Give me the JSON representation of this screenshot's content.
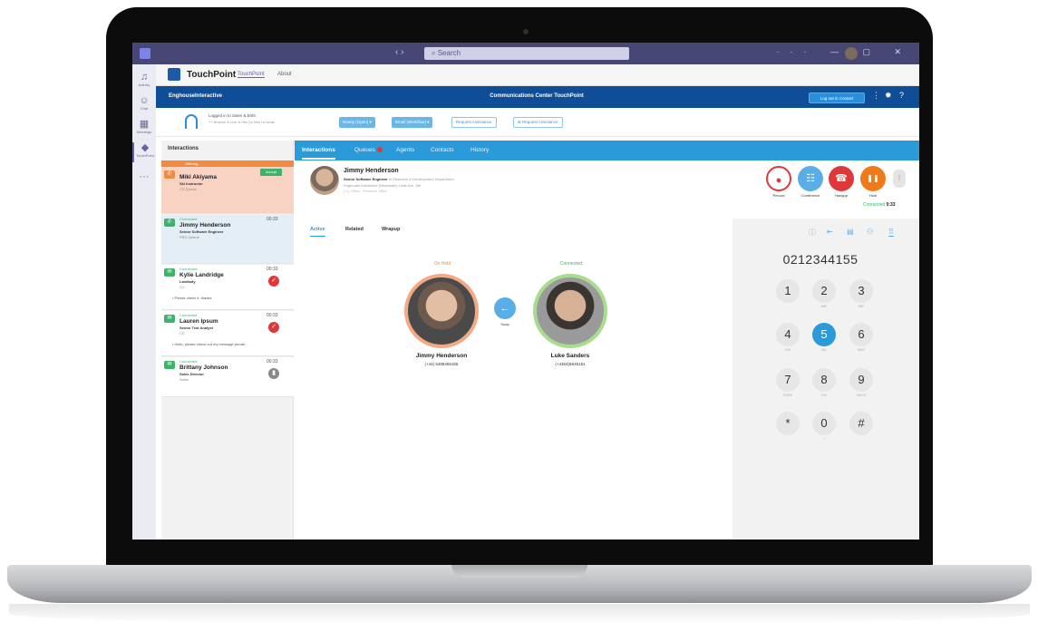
{
  "colors": {
    "teams_purple": "#464775",
    "brand_blue": "#0f4d96",
    "tab_blue": "#2a9ad9",
    "offering_orange": "#f08a3e",
    "connected_green": "#3cb36a",
    "record_red": "#e03838",
    "hangup_red": "#e03838",
    "hold_orange": "#f07a1a",
    "conference_blue": "#5aaee8"
  },
  "titlebar": {
    "search": "Search",
    "nav": "‹ ›"
  },
  "rail": [
    {
      "icon": "bell-icon",
      "glyph": "♫",
      "label": "Activity"
    },
    {
      "icon": "chat-icon",
      "glyph": "☺",
      "label": "Chat"
    },
    {
      "icon": "calendar-icon",
      "glyph": "▦",
      "label": "Meetings"
    },
    {
      "icon": "touchpoint-icon",
      "glyph": "◆",
      "label": "TouchPoint"
    },
    {
      "icon": "more-icon",
      "glyph": "···",
      "label": ""
    }
  ],
  "app_header": {
    "name": "TouchPoint",
    "tab1": "TouchPoint",
    "tab2": "About"
  },
  "bluebar": {
    "brand": "EnghouseInteractive",
    "title": "Communications Center TouchPoint",
    "logout": "Log out in Contact"
  },
  "status": {
    "line1": "Logged in to Sales & Birth",
    "line2": "++ Browse & Live & Hits (to Inlin) a Ideas",
    "ready": "Ready (Open) ▾",
    "avail": "Email (Workflow) ▾",
    "req1": "Request Assistance",
    "req2": "⊕ Request Assistance"
  },
  "interactions": {
    "heading": "Interactions",
    "offering": "Offering...",
    "cards": [
      {
        "name": "Miki Akiyama",
        "role": "Ski Instructor",
        "queue": "CS Queue",
        "state": "",
        "time": "",
        "action": "Accept",
        "msg": ""
      },
      {
        "name": "Jimmy Henderson",
        "role": "Senior Software Engineer",
        "queue": "PRO Queue",
        "state": "Connected",
        "time": "00:33",
        "action": "",
        "msg": ""
      },
      {
        "name": "Kylie Landridge",
        "role": "Landlady",
        "queue": "CC",
        "state": "Connected",
        "time": "00:33",
        "action": "",
        "msg": "• Please check it, thanks"
      },
      {
        "name": "Lauren Ipsum",
        "role": "Senior Test Analyst",
        "queue": "CC",
        "state": "Connected",
        "time": "00:33",
        "action": "",
        "msg": "• Hello, please check out my message penalt..."
      },
      {
        "name": "Brittany Johnson",
        "role": "Sales Director",
        "queue": "Sales",
        "state": "Connected",
        "time": "00:33",
        "action": "",
        "msg": ""
      }
    ]
  },
  "tabs": [
    "Interactions",
    "Queues",
    "Agents",
    "Contacts",
    "History"
  ],
  "contact": {
    "name": "Jimmy Henderson",
    "role": "Senior Software Engineer",
    "role_tail": " in Research & Development Department",
    "org": "Enghouse Interactive (Newcastle) Units five, 6th",
    "phone": "(+1) Office · Resource Office"
  },
  "actions": [
    {
      "label": "Record",
      "glyph": "●"
    },
    {
      "label": "Conference",
      "glyph": "☷"
    },
    {
      "label": "Hangup",
      "glyph": "☎"
    },
    {
      "label": "Hold",
      "glyph": "❚❚"
    }
  ],
  "connected": {
    "label": "Connected",
    "time": "0:33"
  },
  "subtabs": [
    "Active",
    "Related",
    "Wrapup"
  ],
  "parties": [
    {
      "status": "On Hold",
      "name": "Jimmy Henderson",
      "number": "(+44) 5488465155"
    },
    {
      "status": "Connected",
      "name": "Luke Sanders",
      "number": "(+4354)6845151"
    }
  ],
  "swap": "Swap",
  "dialpad": {
    "number": "0212344155",
    "icons": [
      "info-icon",
      "transfer-icon",
      "notes-icon",
      "contacts-icon",
      "dialpad-icon"
    ],
    "keys": [
      {
        "d": "1",
        "s": ""
      },
      {
        "d": "2",
        "s": "ABC"
      },
      {
        "d": "3",
        "s": "DEF"
      },
      {
        "d": "4",
        "s": "GHI"
      },
      {
        "d": "5",
        "s": "JKL"
      },
      {
        "d": "6",
        "s": "MNO"
      },
      {
        "d": "7",
        "s": "PQRS"
      },
      {
        "d": "8",
        "s": "TUV"
      },
      {
        "d": "9",
        "s": "WXYZ"
      },
      {
        "d": "*",
        "s": ""
      },
      {
        "d": "0",
        "s": "+"
      },
      {
        "d": "#",
        "s": ""
      }
    ]
  }
}
